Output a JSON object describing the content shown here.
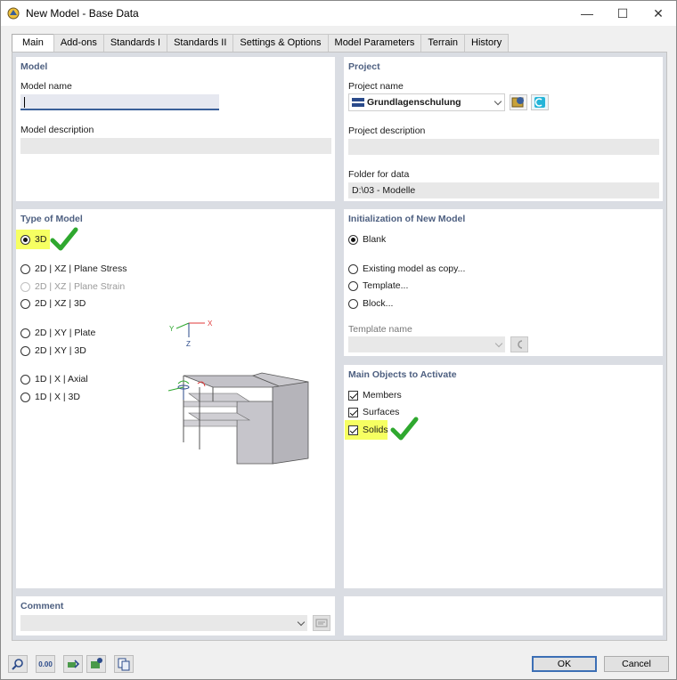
{
  "window": {
    "title": "New Model - Base Data",
    "min": "—",
    "max": "☐",
    "close": "✕"
  },
  "tabs": [
    {
      "label": "Main"
    },
    {
      "label": "Add-ons"
    },
    {
      "label": "Standards I"
    },
    {
      "label": "Standards II"
    },
    {
      "label": "Settings & Options"
    },
    {
      "label": "Model Parameters"
    },
    {
      "label": "Terrain"
    },
    {
      "label": "History"
    }
  ],
  "model": {
    "title": "Model",
    "name_label": "Model name",
    "name_value": "",
    "description_label": "Model description",
    "description_value": ""
  },
  "project": {
    "title": "Project",
    "name_label": "Project name",
    "name_value": "Grundlagenschulung",
    "description_label": "Project description",
    "description_value": "",
    "folder_label": "Folder for data",
    "folder_value": "D:\\03 - Modelle"
  },
  "type_of_model": {
    "title": "Type of Model",
    "options": [
      {
        "label": "3D",
        "selected": true
      },
      {
        "label": "2D | XZ | Plane Stress",
        "selected": false
      },
      {
        "label": "2D | XZ | Plane Strain",
        "selected": false,
        "disabled": true
      },
      {
        "label": "2D | XZ | 3D",
        "selected": false
      },
      {
        "label": "2D | XY | Plate",
        "selected": false
      },
      {
        "label": "2D | XY | 3D",
        "selected": false
      },
      {
        "label": "1D | X | Axial",
        "selected": false
      },
      {
        "label": "1D | X | 3D",
        "selected": false
      }
    ],
    "axes": {
      "x": "X",
      "y": "Y",
      "z": "Z"
    }
  },
  "initialization": {
    "title": "Initialization of New Model",
    "options": [
      {
        "label": "Blank",
        "selected": true
      },
      {
        "label": "Existing model as copy...",
        "selected": false
      },
      {
        "label": "Template...",
        "selected": false
      },
      {
        "label": "Block...",
        "selected": false
      }
    ],
    "template_label": "Template name",
    "template_value": ""
  },
  "main_objects": {
    "title": "Main Objects to Activate",
    "items": [
      {
        "label": "Members",
        "checked": true
      },
      {
        "label": "Surfaces",
        "checked": true
      },
      {
        "label": "Solids",
        "checked": true
      }
    ]
  },
  "comment": {
    "title": "Comment",
    "value": ""
  },
  "footer": {
    "ok_label": "OK",
    "cancel_label": "Cancel",
    "units_label": "0.00"
  },
  "colors": {
    "section_title": "#4d5f80",
    "highlight": "#f6ff62",
    "green_check": "#2fa82f",
    "accent": "#3c6fb5"
  }
}
